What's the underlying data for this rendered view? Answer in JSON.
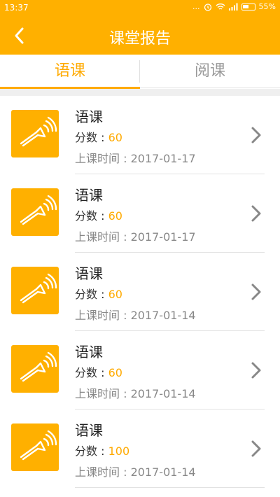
{
  "status_bar": {
    "time": "13:37",
    "dots": "...",
    "battery": "55%"
  },
  "header": {
    "title": "课堂报告",
    "back_icon": "chevron-left-icon"
  },
  "tabs": [
    {
      "label": "语课",
      "active": true
    },
    {
      "label": "阅课",
      "active": false
    }
  ],
  "colors": {
    "brand": "#FFB000",
    "accent": "#FFAA00"
  },
  "reports": [
    {
      "name": "语课",
      "score_label": "分数 : ",
      "score": "60",
      "date_label": "上课时间 : ",
      "date": "2017-01-17"
    },
    {
      "name": "语课",
      "score_label": "分数 : ",
      "score": "60",
      "date_label": "上课时间 : ",
      "date": "2017-01-17"
    },
    {
      "name": "语课",
      "score_label": "分数 : ",
      "score": "60",
      "date_label": "上课时间 : ",
      "date": "2017-01-14"
    },
    {
      "name": "语课",
      "score_label": "分数 : ",
      "score": "60",
      "date_label": "上课时间 : ",
      "date": "2017-01-14"
    },
    {
      "name": "语课",
      "score_label": "分数 : ",
      "score": "100",
      "date_label": "上课时间 : ",
      "date": "2017-01-14"
    }
  ]
}
